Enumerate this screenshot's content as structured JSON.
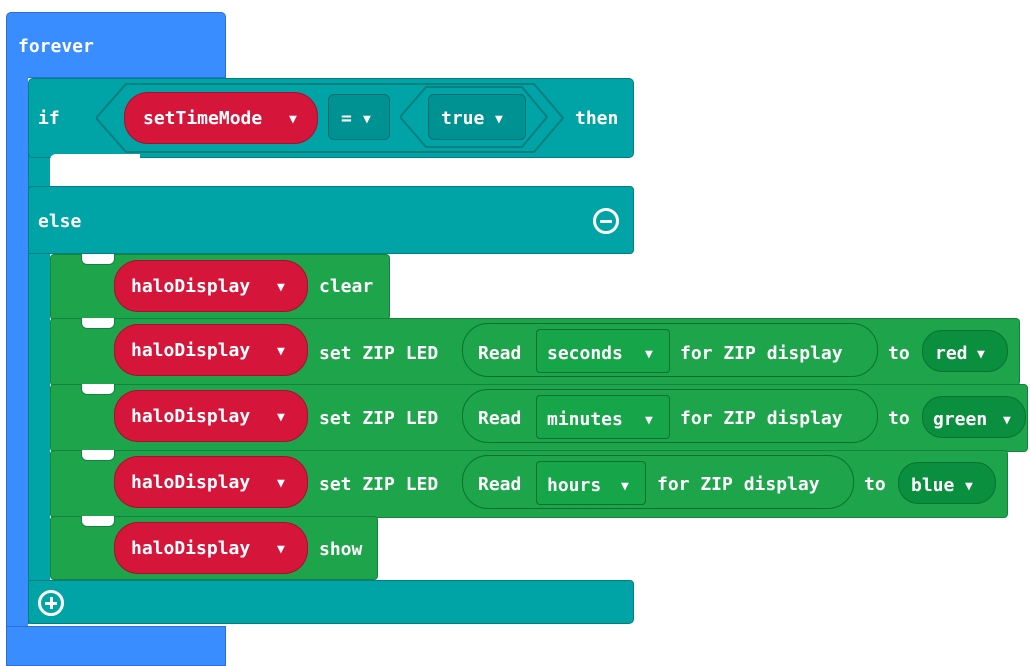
{
  "forever": {
    "label": "forever"
  },
  "if_block": {
    "if_label": "if",
    "then_label": "then",
    "else_label": "else",
    "condition": {
      "left_var": "setTimeMode",
      "operator": "=",
      "right_value": "true"
    }
  },
  "statements": [
    {
      "var": "haloDisplay",
      "action": "clear"
    },
    {
      "var": "haloDisplay",
      "action": "set ZIP LED",
      "read_label": "Read",
      "unit": "seconds",
      "for_label": "for ZIP display",
      "to_label": "to",
      "color": "red"
    },
    {
      "var": "haloDisplay",
      "action": "set ZIP LED",
      "read_label": "Read",
      "unit": "minutes",
      "for_label": "for ZIP display",
      "to_label": "to",
      "color": "green"
    },
    {
      "var": "haloDisplay",
      "action": "set ZIP LED",
      "read_label": "Read",
      "unit": "hours",
      "for_label": "for ZIP display",
      "to_label": "to",
      "color": "blue"
    },
    {
      "var": "haloDisplay",
      "action": "show"
    }
  ],
  "colors": {
    "forever": "#3a8dff",
    "logic": "#00a4a6",
    "variable": "#d6153b",
    "neopixel": "#1ea54b"
  },
  "icons": {
    "caret": "▼",
    "remove_else": "minus-circle-icon",
    "add_else": "plus-circle-icon"
  }
}
